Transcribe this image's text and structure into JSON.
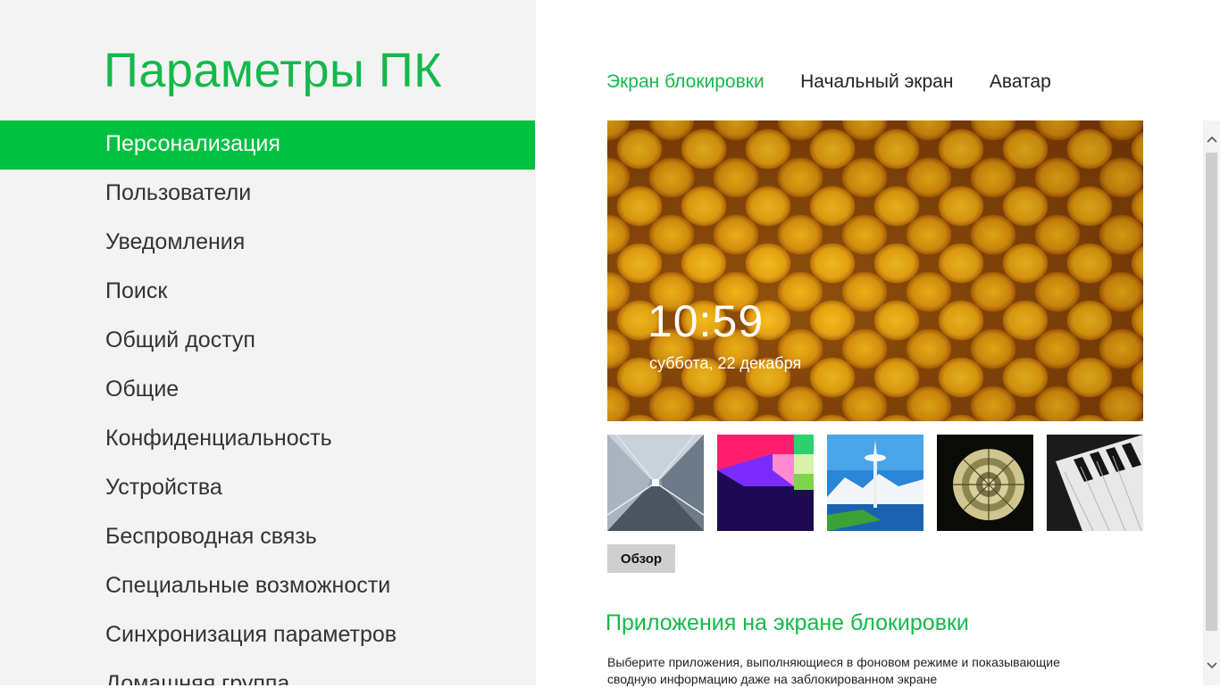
{
  "app": {
    "title": "Параметры ПК"
  },
  "colors": {
    "accent": "#14b94a",
    "selected_bg": "#00c140",
    "left_bg": "#f3f3f3"
  },
  "sidebar": {
    "items": [
      {
        "label": "Персонализация",
        "selected": true
      },
      {
        "label": "Пользователи"
      },
      {
        "label": "Уведомления"
      },
      {
        "label": "Поиск"
      },
      {
        "label": "Общий доступ"
      },
      {
        "label": "Общие"
      },
      {
        "label": "Конфиденциальность"
      },
      {
        "label": "Устройства"
      },
      {
        "label": "Беспроводная связь"
      },
      {
        "label": "Специальные возможности"
      },
      {
        "label": "Синхронизация параметров"
      },
      {
        "label": "Домашняя группа"
      }
    ]
  },
  "tabs": [
    {
      "label": "Экран блокировки",
      "active": true
    },
    {
      "label": "Начальный экран"
    },
    {
      "label": "Аватар"
    }
  ],
  "lockscreen": {
    "time": "10:59",
    "date": "суббота, 22 декабря"
  },
  "thumbnails": [
    {
      "icon": "tunnel-image"
    },
    {
      "icon": "colorful-shapes-image"
    },
    {
      "icon": "space-needle-image"
    },
    {
      "icon": "nautilus-shell-image"
    },
    {
      "icon": "piano-keys-image"
    }
  ],
  "browse": {
    "label": "Обзор"
  },
  "apps_section": {
    "title": "Приложения на экране блокировки",
    "description": "Выберите приложения, выполняющиеся в фоновом режиме и показывающие сводную информацию даже на заблокированном экране"
  },
  "scrollbar": {
    "up_icon": "chevron-up-icon",
    "down_icon": "chevron-down-icon"
  }
}
